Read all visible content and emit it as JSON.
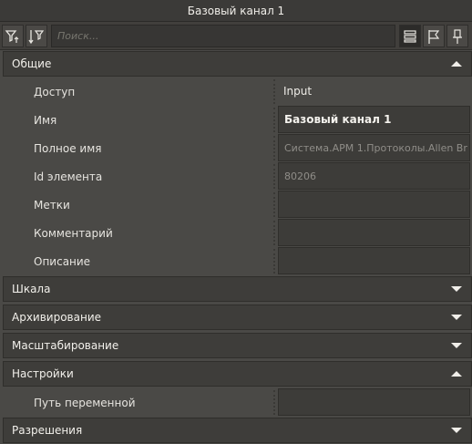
{
  "window": {
    "title": "Базовый канал 1"
  },
  "toolbar": {
    "search_placeholder": "Поиск...",
    "icons": [
      "filter-icon",
      "sort-icon",
      "list-view-icon",
      "flag-icon",
      "pin-icon"
    ]
  },
  "sections": [
    {
      "label": "Общие",
      "expanded": true
    },
    {
      "label": "Шкала",
      "expanded": false
    },
    {
      "label": "Архивирование",
      "expanded": false
    },
    {
      "label": "Масштабирование",
      "expanded": false
    },
    {
      "label": "Настройки",
      "expanded": true
    },
    {
      "label": "Разрешения",
      "expanded": false
    }
  ],
  "general": {
    "rows": [
      {
        "label": "Доступ",
        "value": "Input"
      },
      {
        "label": "Имя",
        "value": "Базовый канал 1"
      },
      {
        "label": "Полное имя",
        "value": "Система.АРМ 1.Протоколы.Allen Br"
      },
      {
        "label": "Id элемента",
        "value": "80206"
      },
      {
        "label": "Метки",
        "value": ""
      },
      {
        "label": "Комментарий",
        "value": ""
      },
      {
        "label": "Описание",
        "value": ""
      }
    ]
  },
  "settings": {
    "rows": [
      {
        "label": "Путь переменной",
        "value": ""
      }
    ]
  },
  "colors": {
    "background": "#4a4946",
    "section": "#3e3d3a",
    "field": "#3d3c39",
    "text": "#e8e6e1",
    "muted": "#8f8d88"
  }
}
